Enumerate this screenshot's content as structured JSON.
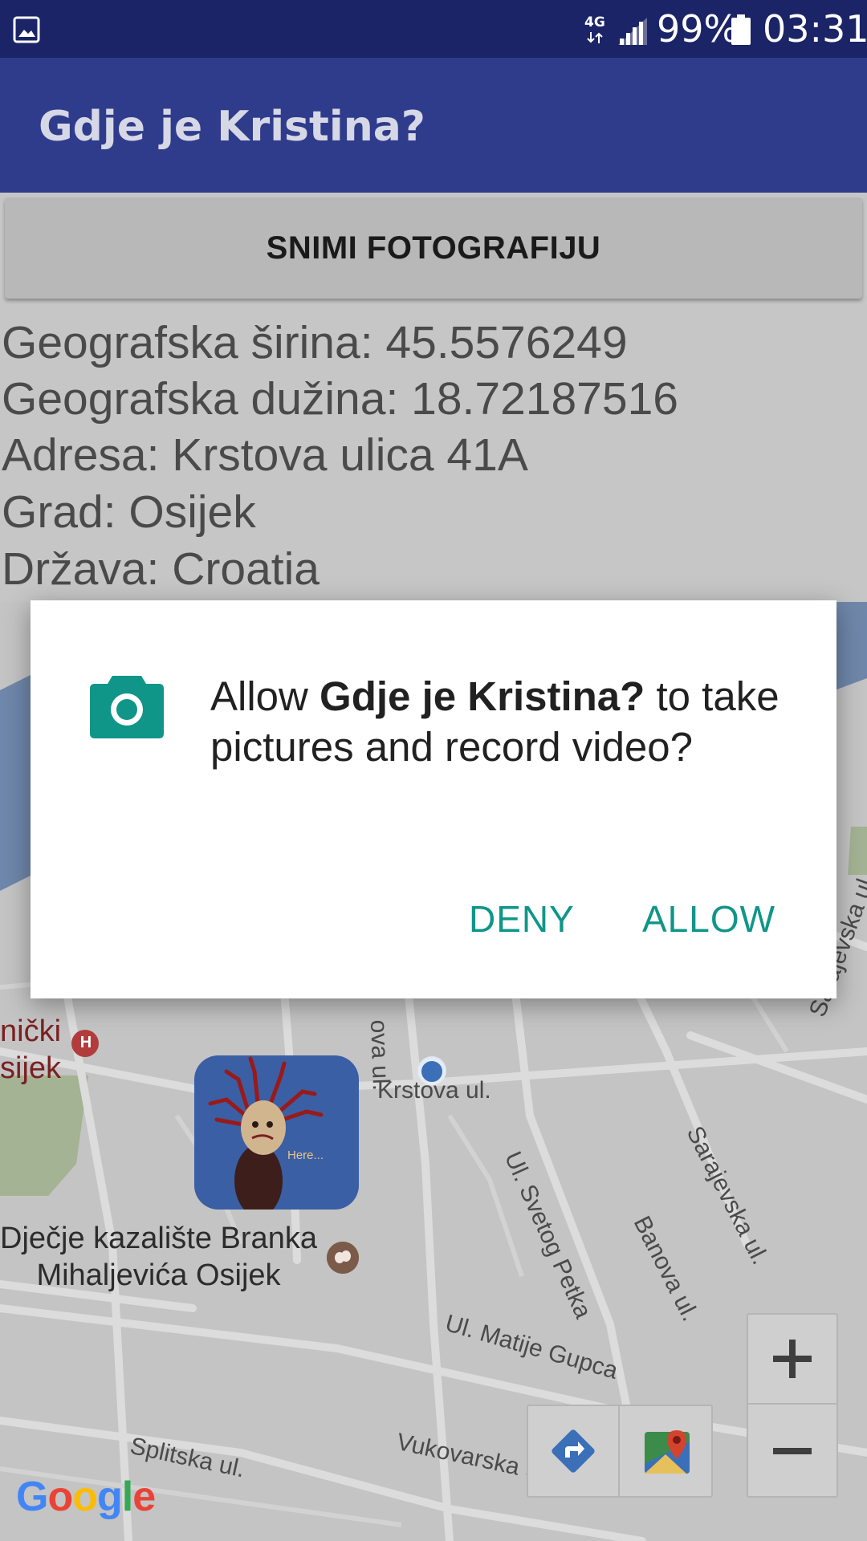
{
  "status_bar": {
    "network": "4G",
    "battery": "99%",
    "time": "03:31"
  },
  "app_bar": {
    "title": "Gdje je Kristina?"
  },
  "main": {
    "capture_button": "SNIMI FOTOGRAFIJU",
    "latitude_line": "Geografska širina: 45.5576249",
    "longitude_line": "Geografska dužina: 18.72187516",
    "address_line": "Adresa: Krstova ulica 41A",
    "city_line": "Grad: Osijek",
    "country_line": "Država: Croatia"
  },
  "map": {
    "poi_theatre_line1": "Dječje kazalište Branka",
    "poi_theatre_line2": "Mihaljevića Osijek",
    "poi_hospital_line1": "nički",
    "poi_hospital_line2": "sijek",
    "hospital_badge": "H",
    "marker_caption": "Here...",
    "streets": {
      "krstova": "Krstova ul.",
      "krstova_vertical": "ova ul.",
      "svetog_petka": "Ul. Svetog Petka",
      "banova": "Banova ul.",
      "sarajevska": "Sarajevska ul.",
      "sarajevska_edge": "Sarajevska ul",
      "matije_gupca": "Ul. Matije Gupca",
      "vukovarska": "Vukovarska ul.",
      "splitska": "Splitska ul."
    },
    "google_logo": [
      "G",
      "o",
      "o",
      "g",
      "l",
      "e"
    ],
    "google_logo_colors": [
      "#4285F4",
      "#EA4335",
      "#FBBC05",
      "#4285F4",
      "#34A853",
      "#EA4335"
    ]
  },
  "dialog": {
    "prefix": "Allow ",
    "app_name": "Gdje je Kristina?",
    "suffix": " to take pictures and record video?",
    "deny": "DENY",
    "allow": "ALLOW",
    "icon": "camera-icon",
    "accent_color": "#0f9688"
  }
}
